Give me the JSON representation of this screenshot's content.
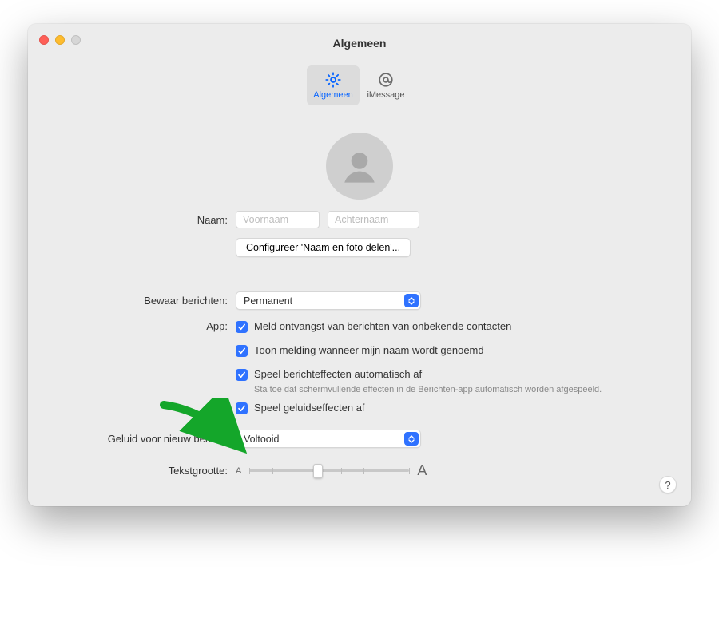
{
  "window": {
    "title": "Algemeen"
  },
  "tabs": {
    "general": {
      "label": "Algemeen"
    },
    "imessage": {
      "label": "iMessage"
    }
  },
  "name": {
    "label": "Naam:",
    "first_placeholder": "Voornaam",
    "last_placeholder": "Achternaam"
  },
  "configure_button": "Configureer 'Naam en foto delen'...",
  "keep": {
    "label": "Bewaar berichten:",
    "value": "Permanent"
  },
  "app": {
    "label": "App:",
    "opt_unknown": "Meld ontvangst van berichten van onbekende contacten",
    "opt_name_mentioned": "Toon melding wanneer mijn naam wordt genoemd",
    "opt_effects": "Speel berichteffecten automatisch af",
    "opt_effects_sub": "Sta toe dat schermvullende effecten in de Berichten-app automatisch worden afgespeeld.",
    "opt_sound": "Speel geluidseffecten af"
  },
  "sound": {
    "label": "Geluid voor nieuw bericht:",
    "value": "Voltooid"
  },
  "textsize": {
    "label": "Tekstgrootte:",
    "small": "A",
    "big": "A"
  },
  "help": "?"
}
